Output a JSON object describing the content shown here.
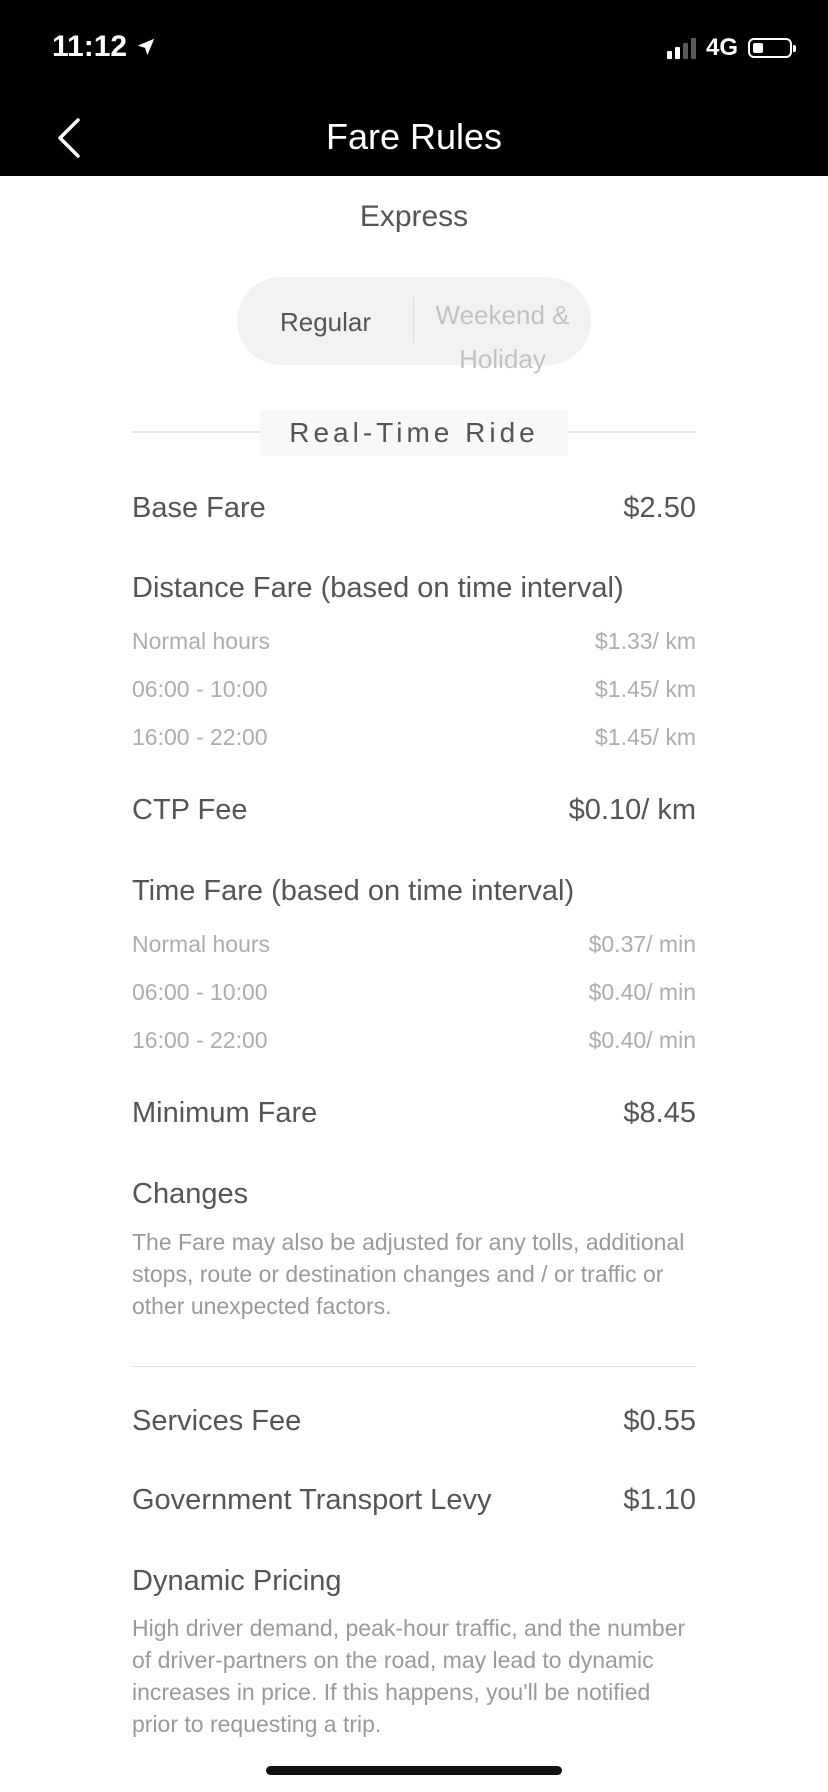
{
  "status_bar": {
    "time": "11:12",
    "network": "4G"
  },
  "nav": {
    "title": "Fare Rules"
  },
  "service": {
    "name": "Express"
  },
  "tabs": {
    "regular": "Regular",
    "weekend": "Weekend & Holiday"
  },
  "section": {
    "title": "Real-Time Ride"
  },
  "base_fare": {
    "label": "Base Fare",
    "value": "$2.50"
  },
  "distance_fare": {
    "label": "Distance Fare (based on time interval)",
    "rows": [
      {
        "label": "Normal hours",
        "value": "$1.33/ km"
      },
      {
        "label": "06:00 - 10:00",
        "value": "$1.45/ km"
      },
      {
        "label": "16:00 - 22:00",
        "value": "$1.45/ km"
      }
    ]
  },
  "ctp_fee": {
    "label": "CTP Fee",
    "value": "$0.10/ km"
  },
  "time_fare": {
    "label": "Time Fare (based on time interval)",
    "rows": [
      {
        "label": "Normal hours",
        "value": "$0.37/ min"
      },
      {
        "label": "06:00 - 10:00",
        "value": "$0.40/ min"
      },
      {
        "label": "16:00 - 22:00",
        "value": "$0.40/ min"
      }
    ]
  },
  "minimum_fare": {
    "label": "Minimum Fare",
    "value": "$8.45"
  },
  "changes": {
    "title": "Changes",
    "text": "The Fare may also be adjusted for any tolls, additional stops, route or destination changes and / or traffic or other unexpected factors."
  },
  "services_fee": {
    "label": "Services Fee",
    "value": "$0.55"
  },
  "gov_levy": {
    "label": "Government Transport Levy",
    "value": "$1.10"
  },
  "dynamic_pricing": {
    "title": "Dynamic Pricing",
    "text": "High driver demand, peak-hour traffic, and the number of driver-partners on the road, may lead to dynamic increases in price. If this happens, you'll be notified prior to requesting a trip."
  },
  "colors": {
    "nav_bg": "#000000",
    "text": "#555555",
    "muted": "#adadad"
  },
  "icons": {
    "back": "chevron-left-icon",
    "location": "location-arrow-icon"
  }
}
